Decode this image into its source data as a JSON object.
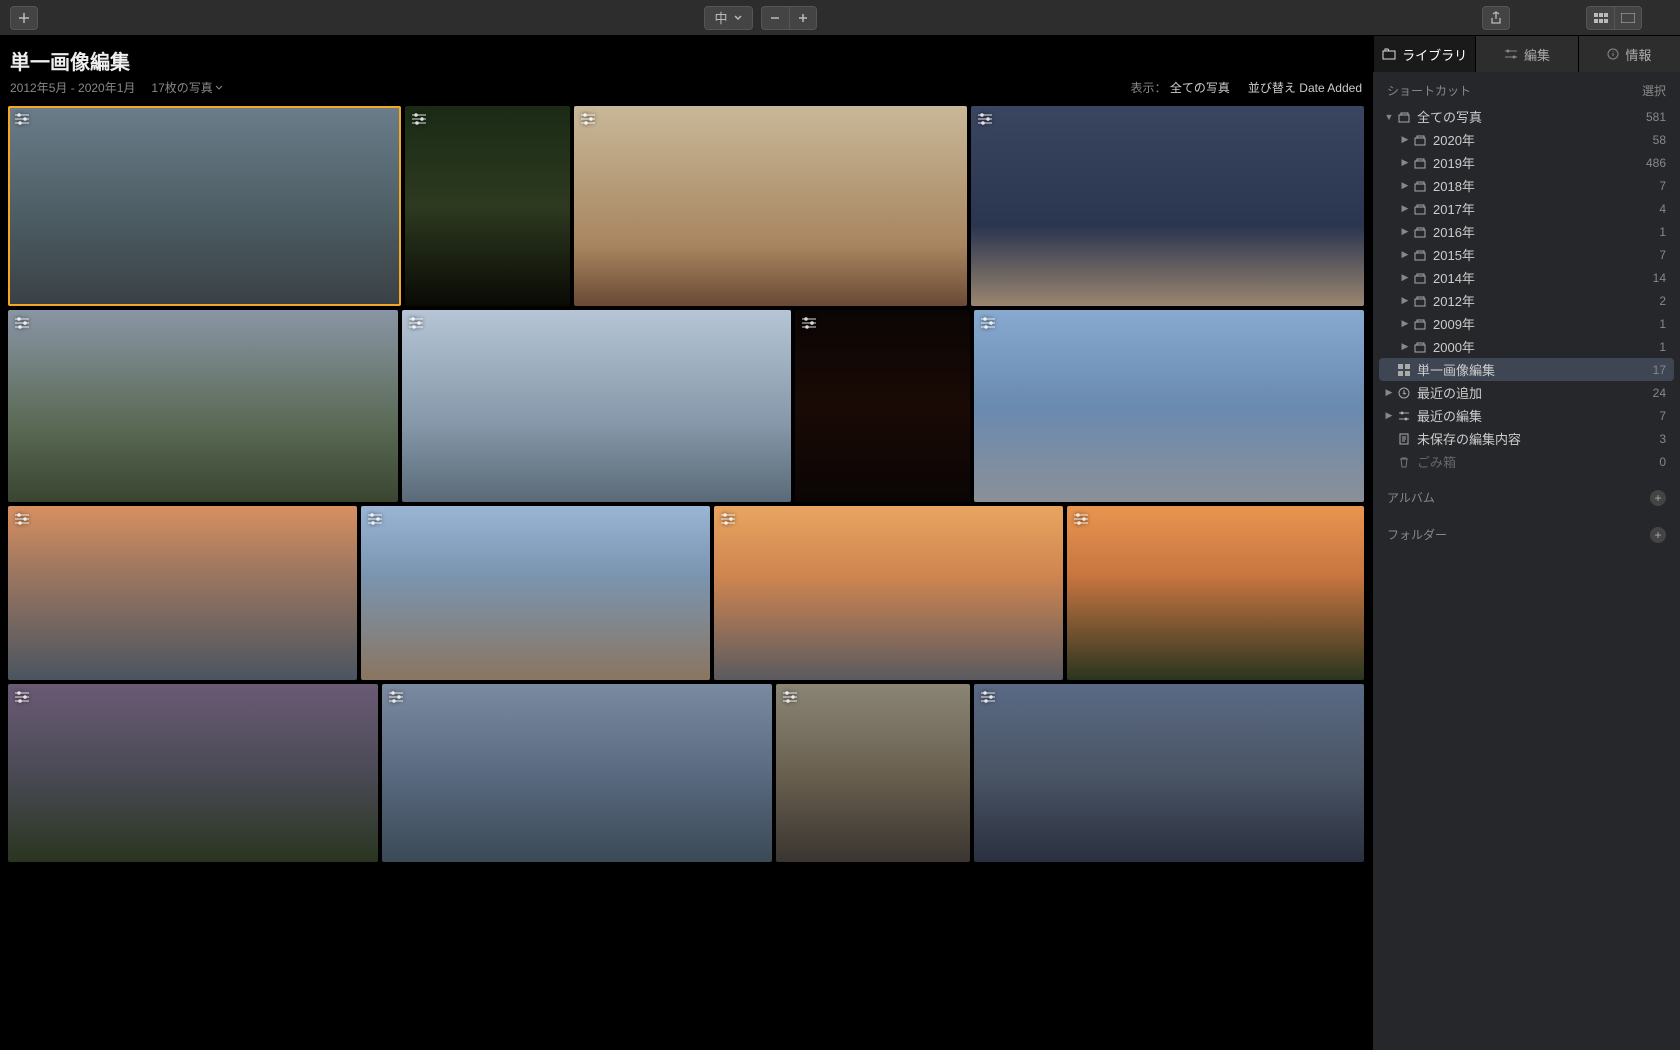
{
  "toolbar": {
    "zoom_label": "中",
    "tabs": {
      "library": "ライブラリ",
      "edit": "編集",
      "info": "情報"
    }
  },
  "header": {
    "title": "単一画像編集",
    "date_range": "2012年5月 - 2020年1月",
    "photo_count": "17枚の写真",
    "filter_label": "表示：",
    "filter_value": "全ての写真",
    "sort_label": "並び替え",
    "sort_value": "Date Added"
  },
  "sidebar": {
    "shortcuts_label": "ショートカット",
    "select_label": "選択",
    "albums_label": "アルバム",
    "folders_label": "フォルダー",
    "items": [
      {
        "label": "全ての写真",
        "count": "581",
        "icon": "stack",
        "expandable": true,
        "expanded": true,
        "indent": 0
      },
      {
        "label": "2020年",
        "count": "58",
        "icon": "stack",
        "expandable": true,
        "indent": 1
      },
      {
        "label": "2019年",
        "count": "486",
        "icon": "stack",
        "expandable": true,
        "indent": 1
      },
      {
        "label": "2018年",
        "count": "7",
        "icon": "stack",
        "expandable": true,
        "indent": 1
      },
      {
        "label": "2017年",
        "count": "4",
        "icon": "stack",
        "expandable": true,
        "indent": 1
      },
      {
        "label": "2016年",
        "count": "1",
        "icon": "stack",
        "expandable": true,
        "indent": 1
      },
      {
        "label": "2015年",
        "count": "7",
        "icon": "stack",
        "expandable": true,
        "indent": 1
      },
      {
        "label": "2014年",
        "count": "14",
        "icon": "stack",
        "expandable": true,
        "indent": 1
      },
      {
        "label": "2012年",
        "count": "2",
        "icon": "stack",
        "expandable": true,
        "indent": 1
      },
      {
        "label": "2009年",
        "count": "1",
        "icon": "stack",
        "expandable": true,
        "indent": 1
      },
      {
        "label": "2000年",
        "count": "1",
        "icon": "stack",
        "expandable": true,
        "indent": 1
      },
      {
        "label": "単一画像編集",
        "count": "17",
        "icon": "grid",
        "selected": true,
        "indent": 0
      },
      {
        "label": "最近の追加",
        "count": "24",
        "icon": "clock",
        "expandable": true,
        "indent": 0
      },
      {
        "label": "最近の編集",
        "count": "7",
        "icon": "sliders",
        "expandable": true,
        "indent": 0
      },
      {
        "label": "未保存の編集内容",
        "count": "3",
        "icon": "doc",
        "indent": 0
      },
      {
        "label": "ごみ箱",
        "count": "0",
        "icon": "trash",
        "indent": 0,
        "dim": true
      }
    ]
  },
  "photos": {
    "rows": [
      {
        "cls": "row1",
        "items": [
          {
            "id": "p0",
            "w": 1,
            "selected": true
          },
          {
            "id": "p1",
            "w": 0.42
          },
          {
            "id": "p2",
            "w": 1
          },
          {
            "id": "p3",
            "w": 1
          }
        ]
      },
      {
        "cls": "row2",
        "items": [
          {
            "id": "p4",
            "w": 1
          },
          {
            "id": "p5",
            "w": 1
          },
          {
            "id": "p6",
            "w": 0.45
          },
          {
            "id": "p7",
            "w": 1
          }
        ]
      },
      {
        "cls": "row3",
        "items": [
          {
            "id": "p8",
            "w": 1
          },
          {
            "id": "p9",
            "w": 1
          },
          {
            "id": "p10",
            "w": 1
          },
          {
            "id": "p11",
            "w": 0.85
          }
        ]
      },
      {
        "cls": "row4",
        "items": [
          {
            "id": "p12",
            "w": 0.95
          },
          {
            "id": "p13",
            "w": 1
          },
          {
            "id": "p14",
            "w": 0.5
          },
          {
            "id": "p15",
            "w": 1
          }
        ]
      }
    ]
  }
}
